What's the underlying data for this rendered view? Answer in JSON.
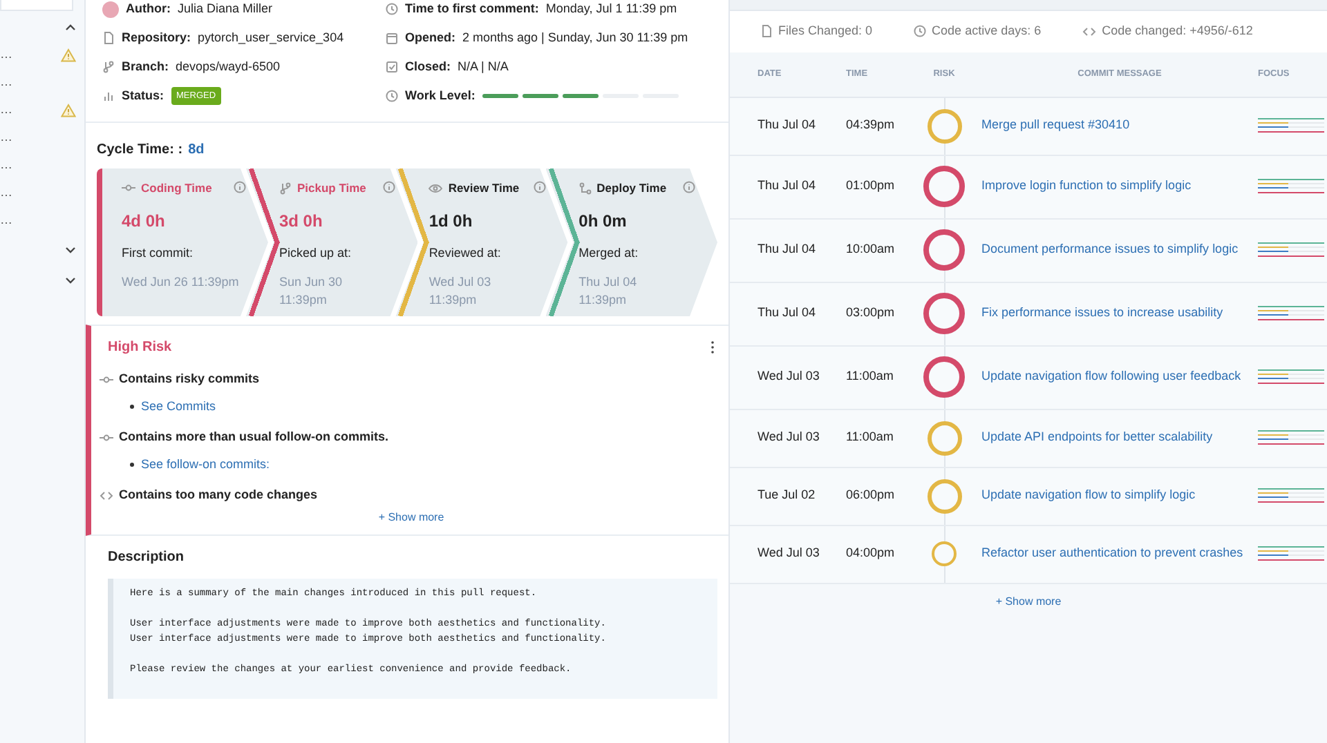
{
  "sidebar": {
    "sections": [
      {
        "expanded": true,
        "items": [
          {
            "label": "…",
            "warning": true
          },
          {
            "label": "…",
            "warning": false
          },
          {
            "label": "…",
            "warning": true
          },
          {
            "label": "…",
            "warning": false
          },
          {
            "label": "…",
            "warning": false
          },
          {
            "label": "…",
            "warning": false
          },
          {
            "label": "…",
            "warning": false
          }
        ]
      },
      {
        "expanded": false
      },
      {
        "expanded": false
      }
    ]
  },
  "details": {
    "left": [
      {
        "kind": "author",
        "label": "Author:",
        "value": "Julia Diana Miller"
      },
      {
        "kind": "repo",
        "label": "Repository:",
        "value": "pytorch_user_service_304"
      },
      {
        "kind": "branch",
        "label": "Branch:",
        "value": "devops/wayd-6500"
      },
      {
        "kind": "status",
        "label": "Status:",
        "badge": "MERGED"
      }
    ],
    "right": [
      {
        "kind": "clock",
        "label": "Time to first comment:",
        "value": "Monday, Jul 1 11:39 pm"
      },
      {
        "kind": "calendar",
        "label": "Opened:",
        "value": "2 months ago | Sunday, Jun 30 11:39 pm"
      },
      {
        "kind": "check",
        "label": "Closed:",
        "value": "N/A | N/A"
      },
      {
        "kind": "level",
        "label": "Work Level:",
        "level": 0.6
      }
    ]
  },
  "cycle_time": {
    "label": "Cycle Time: :",
    "value": "8d",
    "stages": [
      {
        "kind": "coding",
        "title": "Coding Time",
        "value": "4d 0h",
        "caption": "First commit:",
        "date": "Wed Jun 26 11:39pm",
        "color": "#d44a6a",
        "alert": true
      },
      {
        "kind": "pickup",
        "title": "Pickup Time",
        "value": "3d 0h",
        "caption": "Picked up at:",
        "date": "Sun Jun 30 11:39pm",
        "color": "#d44a6a",
        "alert": true
      },
      {
        "kind": "review",
        "title": "Review Time",
        "value": "1d 0h",
        "caption": "Reviewed at:",
        "date": "Wed Jul 03 11:39pm",
        "color": "#e3b745",
        "alert": false
      },
      {
        "kind": "deploy",
        "title": "Deploy Time",
        "value": "0h 0m",
        "caption": "Merged at:",
        "date": "Thu Jul 04 11:39pm",
        "color": "#5cb496",
        "alert": false
      }
    ]
  },
  "risk": {
    "title": "High Risk",
    "items": [
      {
        "kind": "commit",
        "text": "Contains risky commits",
        "link": "See Commits"
      },
      {
        "kind": "commit",
        "text": "Contains more than usual follow-on commits.",
        "link": "See follow-on commits:"
      },
      {
        "kind": "code",
        "text": "Contains too many code changes"
      }
    ],
    "show_more": "+ Show more"
  },
  "description": {
    "title": "Description",
    "paragraphs": [
      [
        "Here is a summary of the main changes introduced in this pull request."
      ],
      [
        "User interface adjustments were made to improve both aesthetics and functionality.",
        "User interface adjustments were made to improve both aesthetics and functionality."
      ],
      [
        "Please review the changes at your earliest convenience and provide feedback."
      ]
    ]
  },
  "stats": [
    {
      "kind": "file",
      "text": "Files Changed: 0"
    },
    {
      "kind": "clock",
      "text": "Code active days: 6"
    },
    {
      "kind": "code",
      "text": "Code changed: +4956/-612"
    }
  ],
  "commits": {
    "columns": [
      "DATE",
      "TIME",
      "RISK",
      "COMMIT MESSAGE",
      "FOCUS"
    ],
    "rows": [
      {
        "date": "Thu Jul 04",
        "time": "04:39pm",
        "kind": "medium",
        "message": "Merge pull request #30410"
      },
      {
        "date": "Thu Jul 04",
        "time": "01:00pm",
        "kind": "high",
        "message": "Improve login function to simplify logic"
      },
      {
        "date": "Thu Jul 04",
        "time": "10:00am",
        "kind": "high",
        "message": "Document performance issues to simplify logic"
      },
      {
        "date": "Thu Jul 04",
        "time": "03:00pm",
        "kind": "high",
        "message": "Fix performance issues to increase usability"
      },
      {
        "date": "Wed Jul 03",
        "time": "11:00am",
        "kind": "high",
        "message": "Update navigation flow following user feedback"
      },
      {
        "date": "Wed Jul 03",
        "time": "11:00am",
        "kind": "medium",
        "message": "Update API endpoints for better scalability"
      },
      {
        "date": "Tue Jul 02",
        "time": "06:00pm",
        "kind": "medium",
        "message": "Update navigation flow to simplify logic"
      },
      {
        "date": "Wed Jul 03",
        "time": "04:00pm",
        "kind": "low",
        "message": "Refactor user authentication to prevent crashes"
      }
    ],
    "show_more": "+ Show more"
  }
}
